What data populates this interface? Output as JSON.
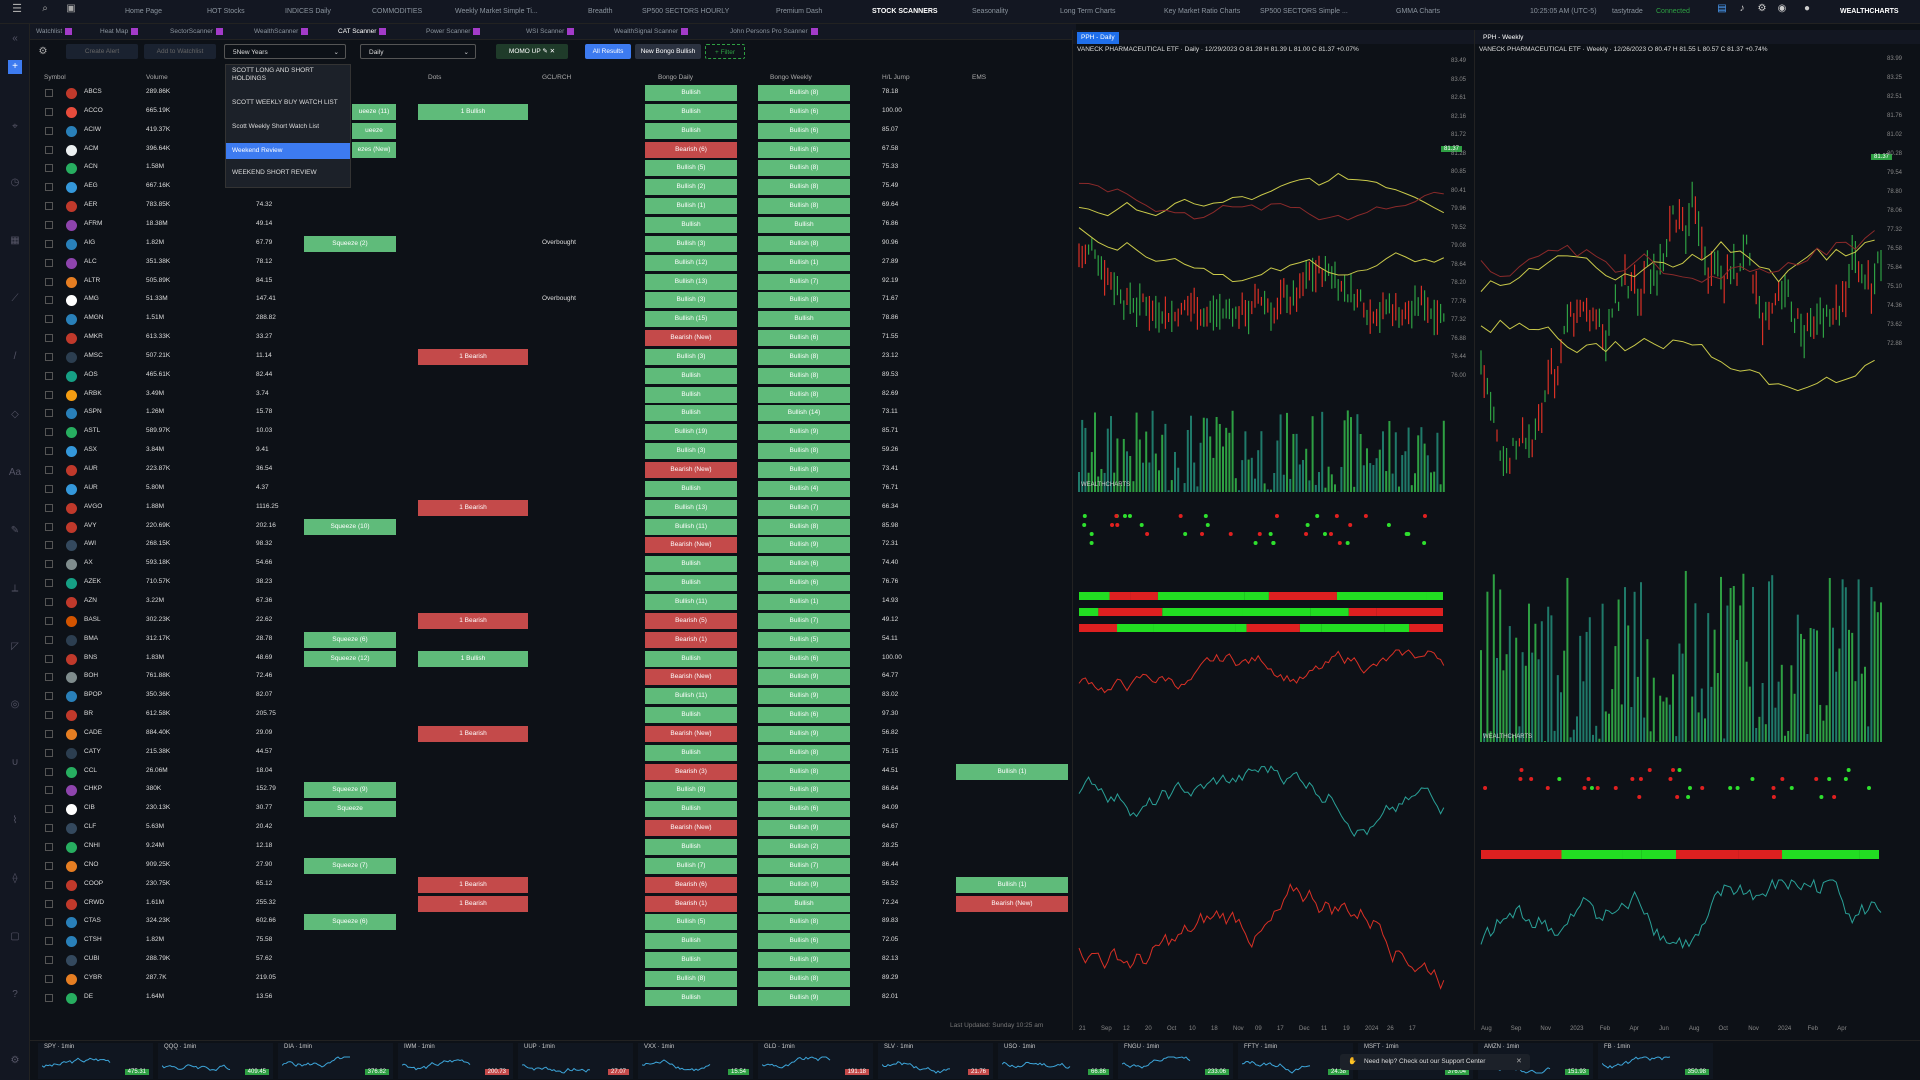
{
  "topbar": {
    "tabs": [
      "Home Page",
      "HOT Stocks",
      "INDICES Daily",
      "COMMODITIES",
      "Weekly Market Simple Ti...",
      "Breadth",
      "SP500 SECTORS HOURLY",
      "Premium Dash",
      "STOCK SCANNERS",
      "Seasonality",
      "Long Term Charts",
      "Key Market Ratio Charts",
      "SP500 SECTORS Simple ...",
      "GMMA Charts"
    ],
    "time": "10:25:05 AM (UTC-5)",
    "broker": "tastytrade",
    "status": "Connected",
    "brand": "WEALTHCHARTS"
  },
  "subtabs": [
    "Watchlist",
    "Heat Map",
    "SectorScanner",
    "WealthScanner",
    "CAT Scanner",
    "Power Scanner",
    "WSI Scanner",
    "WealthSignal Scanner",
    "John Persons Pro Scanner"
  ],
  "toolbar": {
    "create_alert": "Create Alert",
    "add_watchlist": "Add to Watchlist",
    "period": "5New Years",
    "interval": "Daily",
    "scan": "MOMO UP",
    "all_results": "All Results",
    "new_bongo": "New Bongo Bullish",
    "filter": "+ Filter"
  },
  "dropdown": {
    "items": [
      "SCOTT LONG AND SHORT HOLDINGS",
      "SCOTT WEEKLY BUY WATCH LIST",
      "Scott Weekly Short Watch List",
      "Weekend Review",
      "WEEKEND SHORT REVIEW"
    ]
  },
  "columns": [
    "Symbol",
    "Volume",
    "Dots",
    "GCL/RCH",
    "Bongo Daily",
    "Bongo Weekly",
    "H/L Jump",
    "EMS"
  ],
  "rows": [
    [
      "ABCS",
      "289.86K",
      "",
      "",
      "",
      "Bullish",
      "Bullish (8)",
      "78.18",
      ""
    ],
    [
      "ACCO",
      "665.19K",
      "",
      "ueeze (11)",
      "1 Bullish",
      "Bullish",
      "Bullish (6)",
      "100.00",
      ""
    ],
    [
      "ACIW",
      "419.37K",
      "",
      "ueeze",
      "",
      "Bullish",
      "Bullish (6)",
      "85.07",
      ""
    ],
    [
      "ACM",
      "396.64K",
      "",
      "ezes (New)",
      "",
      "Bearish (6)",
      "Bullish (6)",
      "67.58",
      ""
    ],
    [
      "ACN",
      "1.58M",
      "",
      "",
      "",
      "Bullish (5)",
      "Bullish (8)",
      "75.33",
      ""
    ],
    [
      "AEG",
      "667.16K",
      "5.76",
      "",
      "",
      "Bullish (2)",
      "Bullish (8)",
      "75.49",
      ""
    ],
    [
      "AER",
      "783.85K",
      "74.32",
      "",
      "",
      "Bullish (1)",
      "Bullish (8)",
      "69.64",
      ""
    ],
    [
      "AFRM",
      "18.38M",
      "49.14",
      "",
      "",
      "Bullish",
      "Bullish",
      "76.86",
      ""
    ],
    [
      "AIG",
      "1.82M",
      "67.79",
      "Squeeze (2)",
      "",
      "Overbought",
      "Bullish (3)",
      "Bullish (8)",
      "90.96",
      ""
    ],
    [
      "ALC",
      "351.38K",
      "78.12",
      "",
      "",
      "Bullish (12)",
      "Bullish (1)",
      "27.89",
      ""
    ],
    [
      "ALTR",
      "505.89K",
      "84.15",
      "",
      "",
      "Bullish (13)",
      "Bullish (7)",
      "92.19",
      ""
    ],
    [
      "AMG",
      "51.33M",
      "147.41",
      "",
      "",
      "Overbought",
      "Bullish (3)",
      "Bullish (8)",
      "71.67",
      ""
    ],
    [
      "AMGN",
      "1.51M",
      "288.82",
      "",
      "",
      "Bullish (15)",
      "Bullish",
      "78.86",
      ""
    ],
    [
      "AMKR",
      "613.33K",
      "33.27",
      "",
      "",
      "Bearish (New)",
      "Bullish (6)",
      "71.55",
      ""
    ],
    [
      "AMSC",
      "507.21K",
      "11.14",
      "",
      "1 Bearish",
      "Bullish (3)",
      "Bullish (8)",
      "23.12",
      ""
    ],
    [
      "AOS",
      "465.61K",
      "82.44",
      "",
      "",
      "Bullish",
      "Bullish (8)",
      "89.53",
      ""
    ],
    [
      "ARBK",
      "3.49M",
      "3.74",
      "",
      "",
      "Bullish",
      "Bullish (8)",
      "82.69",
      ""
    ],
    [
      "ASPN",
      "1.26M",
      "15.78",
      "",
      "",
      "Bullish",
      "Bullish (14)",
      "73.11",
      ""
    ],
    [
      "ASTL",
      "589.97K",
      "10.03",
      "",
      "",
      "Bullish (19)",
      "Bullish (9)",
      "85.71",
      ""
    ],
    [
      "ASX",
      "3.84M",
      "9.41",
      "",
      "",
      "Bullish (3)",
      "Bullish (8)",
      "59.26",
      ""
    ],
    [
      "AUR",
      "223.87K",
      "36.54",
      "",
      "",
      "Bearish (New)",
      "Bullish (8)",
      "73.41",
      ""
    ],
    [
      "AUR",
      "5.80M",
      "4.37",
      "",
      "",
      "Bullish",
      "Bullish (4)",
      "76.71",
      ""
    ],
    [
      "AVGO",
      "1.88M",
      "1116.25",
      "",
      "1 Bearish",
      "Bullish (13)",
      "Bullish (7)",
      "66.34",
      ""
    ],
    [
      "AVY",
      "220.69K",
      "202.16",
      "Squeeze (10)",
      "",
      "Bullish (11)",
      "Bullish (8)",
      "85.98",
      ""
    ],
    [
      "AWI",
      "268.15K",
      "98.32",
      "",
      "",
      "Bearish (New)",
      "Bullish (9)",
      "72.31",
      ""
    ],
    [
      "AX",
      "593.18K",
      "54.66",
      "",
      "",
      "Bullish",
      "Bullish (6)",
      "74.40",
      ""
    ],
    [
      "AZEK",
      "710.57K",
      "38.23",
      "",
      "",
      "Bullish",
      "Bullish (6)",
      "76.76",
      ""
    ],
    [
      "AZN",
      "3.22M",
      "67.36",
      "",
      "",
      "Bullish (11)",
      "Bullish (1)",
      "14.93",
      ""
    ],
    [
      "BASL",
      "302.23K",
      "22.62",
      "",
      "1 Bearish",
      "Bearish (5)",
      "Bullish (7)",
      "49.12",
      ""
    ],
    [
      "BMA",
      "312.17K",
      "28.78",
      "Squeeze (6)",
      "",
      "Bearish (1)",
      "Bullish (5)",
      "54.11",
      ""
    ],
    [
      "BNS",
      "1.83M",
      "48.69",
      "Squeeze (12)",
      "1 Bullish",
      "Bullish",
      "Bullish (6)",
      "100.00",
      ""
    ],
    [
      "BOH",
      "761.88K",
      "72.46",
      "",
      "",
      "Bearish (New)",
      "Bullish (9)",
      "64.77",
      ""
    ],
    [
      "BPOP",
      "350.36K",
      "82.07",
      "",
      "",
      "Bullish (11)",
      "Bullish (9)",
      "83.02",
      ""
    ],
    [
      "BR",
      "612.58K",
      "205.75",
      "",
      "",
      "Bullish",
      "Bullish (6)",
      "97.30",
      ""
    ],
    [
      "CADE",
      "884.40K",
      "29.09",
      "",
      "1 Bearish",
      "Bearish (New)",
      "Bullish (9)",
      "56.82",
      ""
    ],
    [
      "CATY",
      "215.38K",
      "44.57",
      "",
      "",
      "Bullish",
      "Bullish (8)",
      "75.15",
      ""
    ],
    [
      "CCL",
      "26.06M",
      "18.04",
      "",
      "",
      "Bearish (3)",
      "Bullish (8)",
      "44.51",
      "Bullish (1)"
    ],
    [
      "CHKP",
      "380K",
      "152.79",
      "Squeeze (9)",
      "",
      "Bullish (8)",
      "Bullish (8)",
      "86.64",
      ""
    ],
    [
      "CIB",
      "230.13K",
      "30.77",
      "Squeeze",
      "",
      "Bullish",
      "Bullish (6)",
      "84.09",
      ""
    ],
    [
      "CLF",
      "5.63M",
      "20.42",
      "",
      "",
      "Bearish (New)",
      "Bullish (9)",
      "64.67",
      ""
    ],
    [
      "CNHI",
      "9.24M",
      "12.18",
      "",
      "",
      "Bullish",
      "Bullish (2)",
      "28.25",
      ""
    ],
    [
      "CNO",
      "909.25K",
      "27.90",
      "Squeeze (7)",
      "",
      "Bullish (7)",
      "Bullish (7)",
      "86.44",
      ""
    ],
    [
      "COOP",
      "230.75K",
      "65.12",
      "",
      "1 Bearish",
      "Bearish (6)",
      "Bullish (9)",
      "56.52",
      "Bullish (1)"
    ],
    [
      "CRWD",
      "1.61M",
      "255.32",
      "",
      "1 Bearish",
      "Bearish (1)",
      "Bullish",
      "72.24",
      "Bearish (New)"
    ],
    [
      "CTAS",
      "324.23K",
      "602.66",
      "Squeeze (6)",
      "",
      "Bullish (5)",
      "Bullish (8)",
      "89.83",
      ""
    ],
    [
      "CTSH",
      "1.82M",
      "75.58",
      "",
      "",
      "Bullish",
      "Bullish (6)",
      "72.05",
      ""
    ],
    [
      "CUBI",
      "288.79K",
      "57.62",
      "",
      "",
      "Bullish",
      "Bullish (9)",
      "82.13",
      ""
    ],
    [
      "CYBR",
      "287.7K",
      "219.05",
      "",
      "",
      "Bullish (8)",
      "Bullish (8)",
      "89.29",
      ""
    ],
    [
      "DE",
      "1.64M",
      "13.56",
      "",
      "",
      "Bullish",
      "Bullish (9)",
      "82.01",
      ""
    ]
  ],
  "last_updated": "Last Updated: Sunday 10:25 am",
  "chart1": {
    "tab": "PPH - Daily",
    "title": "VANECK PHARMACEUTICAL ETF · Daily · 12/29/2023 O 81.28 H 81.39 L 81.00 C 81.37 +0.07%",
    "price": "81.37",
    "brand": "WEALTHCHARTS",
    "x_labels": [
      "21",
      "Sep",
      "12",
      "20",
      "Oct",
      "10",
      "18",
      "Nov",
      "09",
      "17",
      "Dec",
      "11",
      "19",
      "2024",
      "26",
      "17"
    ],
    "y_labels": [
      "83.49",
      "83.05",
      "82.61",
      "82.16",
      "81.72",
      "81.28",
      "80.85",
      "80.41",
      "79.96",
      "79.52",
      "79.08",
      "78.64",
      "78.20",
      "77.76",
      "77.32",
      "76.88",
      "76.44",
      "76.00"
    ]
  },
  "chart2": {
    "tab": "PPH - Weekly",
    "title": "VANECK PHARMACEUTICAL ETF · Weekly · 12/26/2023 O 80.47 H 81.55 L 80.57 C 81.37 +0.74%",
    "price": "81.37",
    "brand": "WEALTHCHARTS",
    "x_labels": [
      "Aug",
      "Sep",
      "Nov",
      "2023",
      "Feb",
      "Apr",
      "Jun",
      "Aug",
      "Oct",
      "Nov",
      "2024",
      "Feb",
      "Apr"
    ],
    "y_labels": [
      "83.99",
      "83.25",
      "82.51",
      "81.76",
      "81.02",
      "80.28",
      "79.54",
      "78.80",
      "78.06",
      "77.32",
      "76.58",
      "75.84",
      "75.10",
      "74.36",
      "73.62",
      "72.88"
    ]
  },
  "tickers": [
    [
      "SPY · 1min",
      "475.31"
    ],
    [
      "QQQ · 1min",
      "409.45"
    ],
    [
      "DIA · 1min",
      "376.82"
    ],
    [
      "IWM · 1min",
      "200.73"
    ],
    [
      "UUP · 1min",
      "27.07"
    ],
    [
      "VXX · 1min",
      "15.54"
    ],
    [
      "GLD · 1min",
      "191.18"
    ],
    [
      "SLV · 1min",
      "21.76"
    ],
    [
      "USO · 1min",
      "66.86"
    ],
    [
      "FNGU · 1min",
      "233.06"
    ],
    [
      "FFTY · 1min",
      "24.38"
    ],
    [
      "MSFT · 1min",
      "376.04"
    ],
    [
      "AMZN · 1min",
      "151.93"
    ],
    [
      "FB · 1min",
      "350.98"
    ]
  ],
  "help": "Need help? Check out our Support Center",
  "colors": {
    "bull": "#5fbb7a",
    "bear": "#c44a4a",
    "accent": "#3d7bf0"
  }
}
